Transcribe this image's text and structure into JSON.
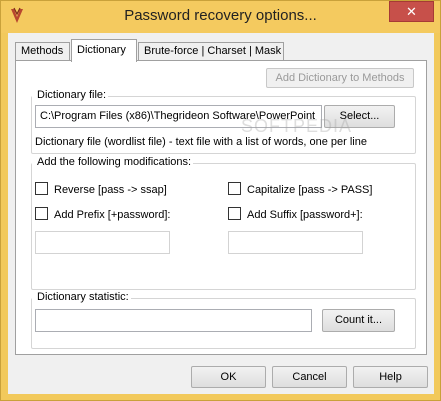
{
  "window": {
    "title": "Password recovery options..."
  },
  "tabs": [
    {
      "label": "Methods"
    },
    {
      "label": "Dictionary"
    },
    {
      "label": "Brute-force | Charset | Mask"
    }
  ],
  "dictionary": {
    "add_button": "Add Dictionary to Methods",
    "file_group_label": "Dictionary file:",
    "file_path": "C:\\Program Files (x86)\\Thegrideon Software\\PowerPoint",
    "select_button": "Select...",
    "hint": "Dictionary file (wordlist file) - text file with a list of words, one per line",
    "mods_group_label": "Add the following modifications:",
    "mods": {
      "reverse": "Reverse [pass -> ssap]",
      "capitalize": "Capitalize [pass -> PASS]",
      "prefix": "Add Prefix [+password]:",
      "suffix": "Add Suffix [password+]:"
    },
    "stat_group_label": "Dictionary statistic:",
    "count_button": "Count it..."
  },
  "footer": {
    "ok": "OK",
    "cancel": "Cancel",
    "help": "Help"
  },
  "watermark": "SOFTPEDIA",
  "colors": {
    "title_bar": "#f4ca5f",
    "close_button": "#c7504a"
  }
}
